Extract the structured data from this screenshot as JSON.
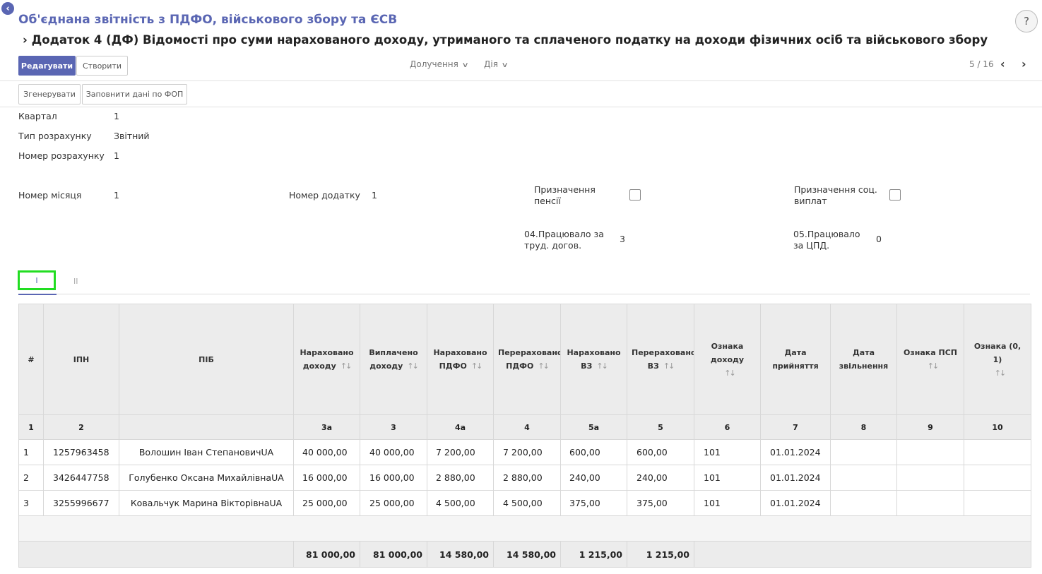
{
  "header": {
    "app_title": "Об'єднана звітність з ПДФО, військового збору та ЄСВ",
    "doc_title": "Додаток 4 (ДФ) Відомості про суми нарахованого доходу, утриманого та сплаченого податку на доходи фізичних осіб та військового збору",
    "help": "?"
  },
  "toolbar": {
    "edit_label": "Редагувати",
    "create_label": "Створити",
    "attach_label": "Долучення",
    "action_label": "Дія",
    "pager": "5 / 16"
  },
  "actions": {
    "generate_label": "Згенерувати",
    "fill_fop_label": "Заповнити дані по ФОП"
  },
  "form": {
    "quarter_label": "Квартал",
    "quarter_value": "1",
    "calc_type_label": "Тип розрахунку",
    "calc_type_value": "Звітний",
    "calc_number_label": "Номер розрахунку",
    "calc_number_value": "1",
    "month_label": "Номер місяця",
    "month_value": "1",
    "appendix_label": "Номер додатку",
    "appendix_value": "1",
    "pension_label": "Призначення пенсії",
    "social_label": "Призначення соц. виплат",
    "labor_label": "04.Працювало за труд. догов.",
    "labor_value": "3",
    "gpd_label": "05.Працювало за ЦПД.",
    "gpd_value": "0"
  },
  "tabs": {
    "tab1": "I",
    "tab2": "II"
  },
  "table": {
    "headers": {
      "num": "#",
      "ipn": "ІПН",
      "pib": "ПІБ",
      "income_accrued": "Нараховано доходу",
      "income_paid": "Виплачено доходу",
      "pdfo_accrued": "Нараховано ПДФО",
      "pdfo_transferred": "Перераховано ПДФО",
      "vz_accrued": "Нараховано ВЗ",
      "vz_transferred": "Перераховано ВЗ",
      "income_sign": "Ознака доходу",
      "hire_date": "Дата прийняття",
      "dismiss_date": "Дата звільнення",
      "psp_sign": "Ознака ПСП",
      "sign01": "Ознака (0, 1)"
    },
    "column_numbers": [
      "1",
      "2",
      "",
      "3а",
      "3",
      "4а",
      "4",
      "5а",
      "5",
      "6",
      "7",
      "8",
      "9",
      "10"
    ],
    "rows": [
      {
        "n": "1",
        "ipn": "1257963458",
        "pib": "Волошин Іван СтепановичUA",
        "c3a": "40 000,00",
        "c3": "40 000,00",
        "c4a": "7 200,00",
        "c4": "7 200,00",
        "c5a": "600,00",
        "c5": "600,00",
        "c6": "101",
        "c7": "01.01.2024",
        "c8": "",
        "c9": "",
        "c10": ""
      },
      {
        "n": "2",
        "ipn": "3426447758",
        "pib": "Голубенко Оксана МихайлівнаUA",
        "c3a": "16 000,00",
        "c3": "16 000,00",
        "c4a": "2 880,00",
        "c4": "2 880,00",
        "c5a": "240,00",
        "c5": "240,00",
        "c6": "101",
        "c7": "01.01.2024",
        "c8": "",
        "c9": "",
        "c10": ""
      },
      {
        "n": "3",
        "ipn": "3255996677",
        "pib": "Ковальчук Марина ВікторівнаUA",
        "c3a": "25 000,00",
        "c3": "25 000,00",
        "c4a": "4 500,00",
        "c4": "4 500,00",
        "c5a": "375,00",
        "c5": "375,00",
        "c6": "101",
        "c7": "01.01.2024",
        "c8": "",
        "c9": "",
        "c10": ""
      }
    ],
    "totals": {
      "c3a": "81 000,00",
      "c3": "81 000,00",
      "c4a": "14 580,00",
      "c4": "14 580,00",
      "c5a": "1 215,00",
      "c5": "1 215,00"
    }
  }
}
